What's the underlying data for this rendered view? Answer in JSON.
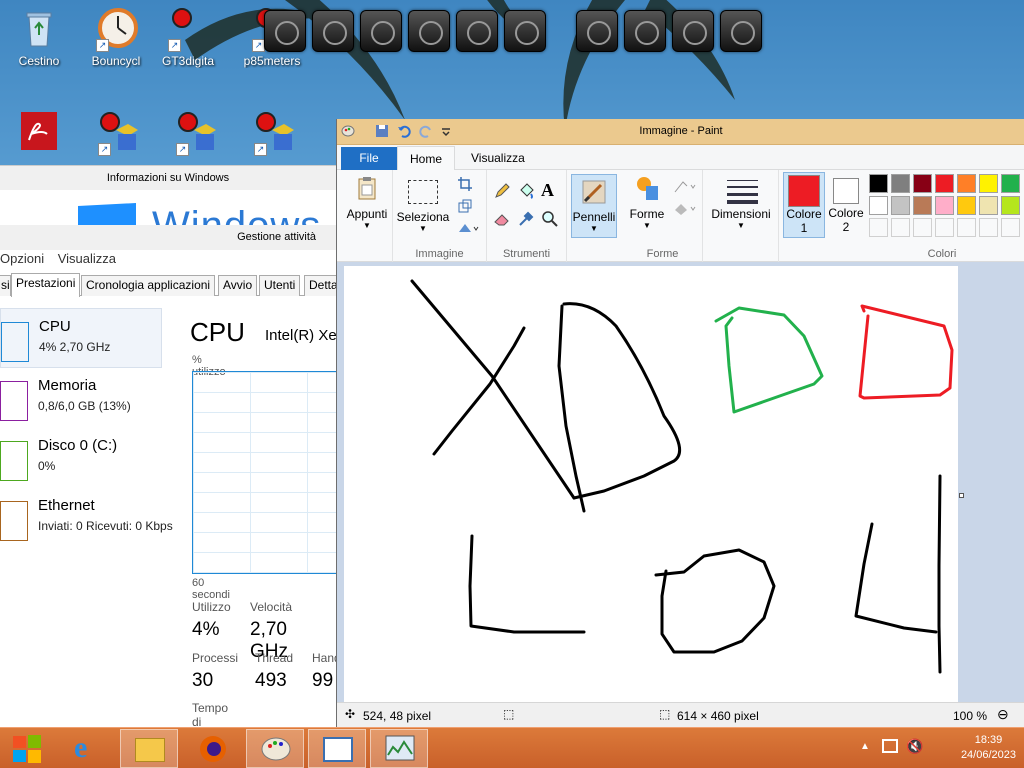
{
  "desktop": {
    "icons_row1": [
      {
        "label": "Cestino",
        "icon": "recycle-bin-icon"
      },
      {
        "label": "Bouncycl",
        "icon": "clock-gadget-icon"
      },
      {
        "label": "GT3digita",
        "icon": "gadget-icon"
      },
      {
        "label": "p85meters",
        "icon": "gadget-icon"
      }
    ],
    "icons_row2": [
      {
        "label": "",
        "icon": "pdf-icon"
      },
      {
        "label": "",
        "icon": "network-gadget-icon"
      },
      {
        "label": "",
        "icon": "network-gadget-icon"
      },
      {
        "label": "",
        "icon": "network-gadget-icon"
      }
    ]
  },
  "info_window": {
    "title": "Informazioni su Windows",
    "brand": "Windows"
  },
  "task_manager": {
    "title": "Gestione attività",
    "menu": [
      "Opzioni",
      "Visualizza"
    ],
    "tabs": [
      "si",
      "Prestazioni",
      "Cronologia applicazioni",
      "Avvio",
      "Utenti",
      "Detta"
    ],
    "side": [
      {
        "name": "CPU",
        "sub": "4% 2,70 GHz",
        "color": "#1f89d6"
      },
      {
        "name": "Memoria",
        "sub": "0,8/6,0 GB (13%)",
        "color": "#8b1fa0"
      },
      {
        "name": "Disco 0 (C:)",
        "sub": "0%",
        "color": "#4da81f"
      },
      {
        "name": "Ethernet",
        "sub": "Inviati: 0 Ricevuti: 0 Kbps",
        "color": "#a8651f"
      }
    ],
    "heading": "CPU",
    "cpu_name": "Intel(R) Xe",
    "util_label": "% utilizzo",
    "seconds_label": "60 secondi",
    "stats": {
      "util_label": "Utilizzo",
      "util_value": "4%",
      "speed_label": "Velocità",
      "speed_value": "2,70 GHz",
      "proc_label": "Processi",
      "proc_value": "30",
      "thread_label": "Thread",
      "thread_value": "493",
      "handle_label": "Hand",
      "handle_value": "99",
      "uptime_label": "Tempo di attività"
    }
  },
  "paint": {
    "title": "Immagine - Paint",
    "tabs": {
      "file": "File",
      "home": "Home",
      "view": "Visualizza"
    },
    "groups": {
      "clipboard": "Appunti",
      "image": "Immagine",
      "select": "Seleziona",
      "tools": "Strumenti",
      "brushes": "Pennelli",
      "shapes_group": "Forme",
      "shapes": "Forme",
      "size": "Dimensioni",
      "color1": "Colore",
      "color1_num": "1",
      "color2": "Colore",
      "color2_num": "2",
      "colors": "Colori"
    },
    "color1_value": "#ed1c24",
    "color2_value": "#ffffff",
    "palette_row1": [
      "#000000",
      "#7f7f7f",
      "#880015",
      "#ed1c24",
      "#ff7f27",
      "#fff200",
      "#22b14c"
    ],
    "palette_row2": [
      "#ffffff",
      "#c3c3c3",
      "#b97a57",
      "#ffaec9",
      "#ffc90e",
      "#efe4b0",
      "#b5e61d"
    ],
    "status": {
      "cursor": "524, 48 pixel",
      "size": "614 × 460 pixel",
      "zoom": "100 %"
    }
  },
  "taskbar": {
    "time": "18:39",
    "date": "24/06/2023"
  }
}
